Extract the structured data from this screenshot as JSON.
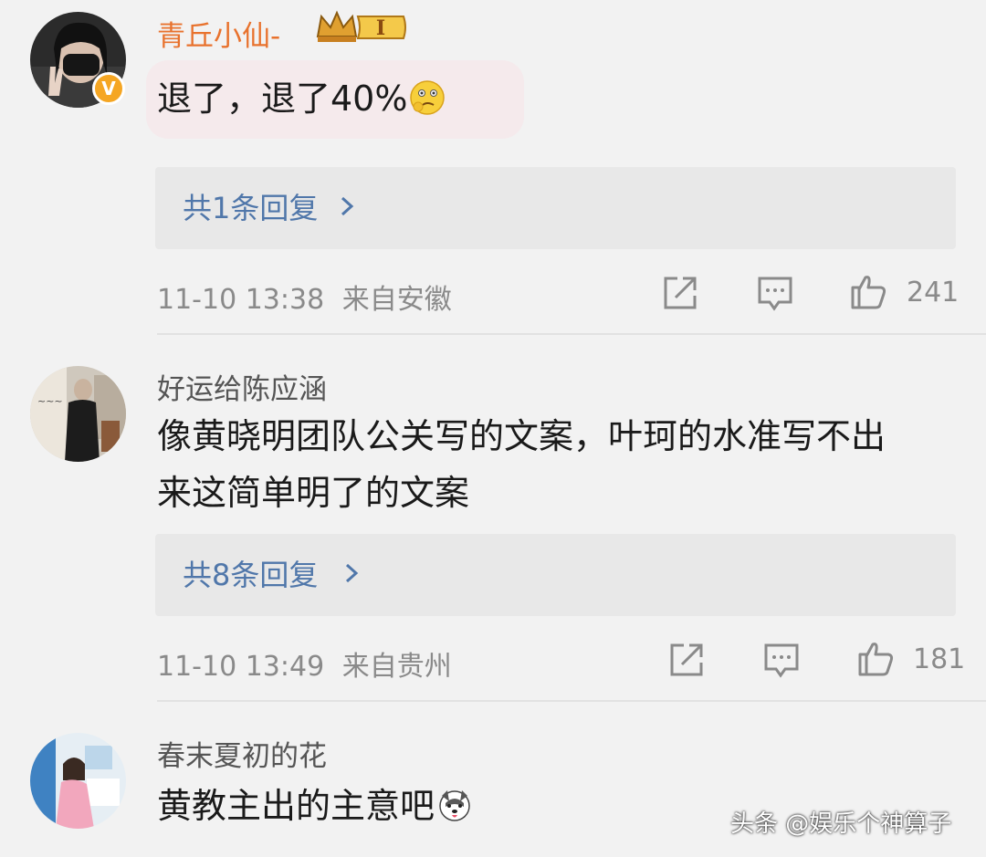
{
  "comments": [
    {
      "username": "青丘小仙-",
      "vip_level": "I",
      "verified_mark": "V",
      "text": "退了，退了40%",
      "replies_label": "共1条回复",
      "timestamp": "11-10 13:38",
      "location": "来自安徽",
      "likes": "241"
    },
    {
      "username": "好运给陈应涵",
      "text_line1": "像黄晓明团队公关写的文案，叶珂的水准写不出",
      "text_line2": "来这简单明了的文案",
      "replies_label": "共8条回复",
      "timestamp": "11-10 13:49",
      "location": "来自贵州",
      "likes": "181"
    },
    {
      "username": "春末夏初的花",
      "text": "黄教主出的主意吧"
    }
  ],
  "watermark": "头条 @娱乐个神算子",
  "colors": {
    "vip_name": "#e8722d",
    "link_blue": "#5077aa",
    "meta_gray": "#8a8a8a",
    "background": "#f2f2f2"
  }
}
